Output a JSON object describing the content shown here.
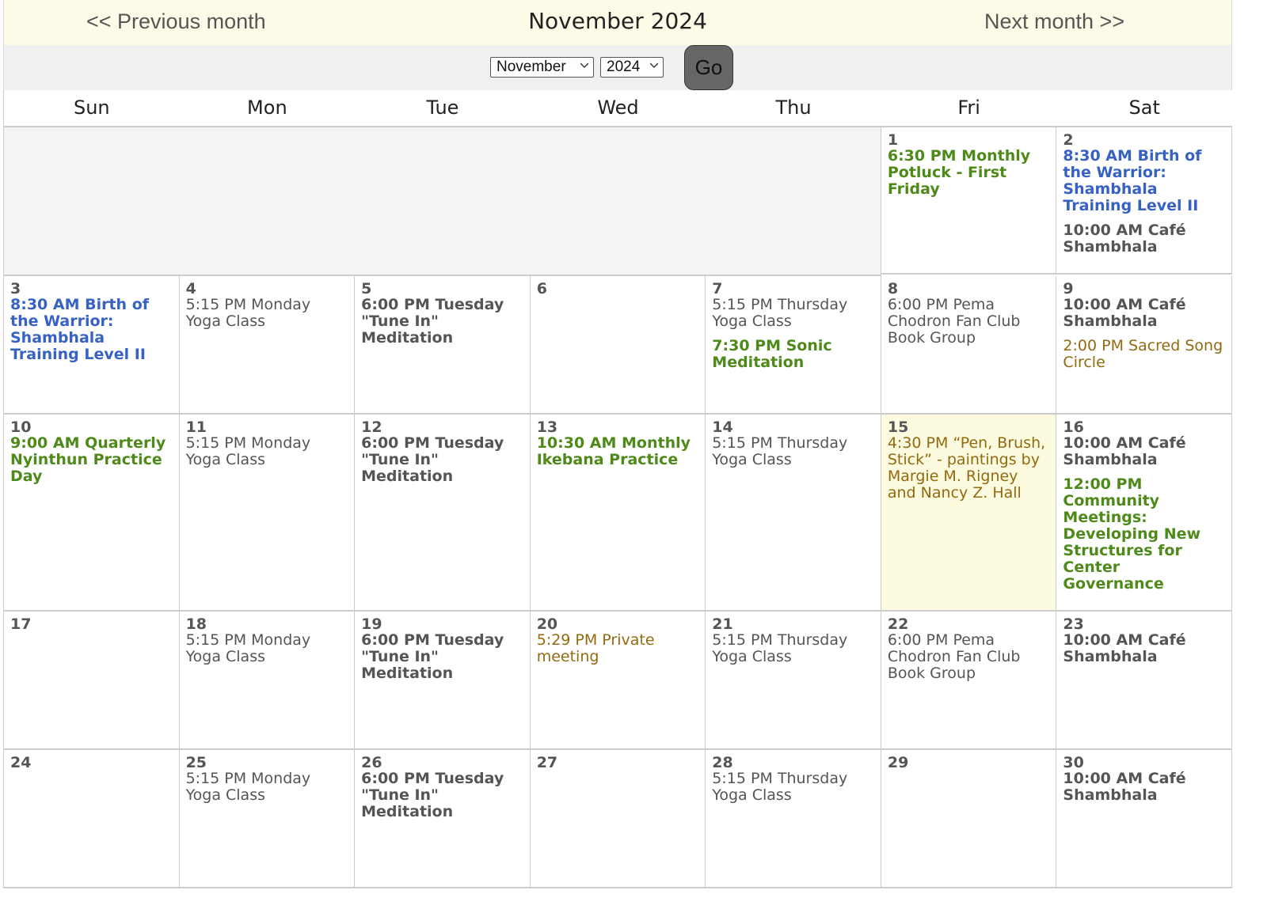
{
  "nav": {
    "prev": "<< Previous month",
    "title": "November 2024",
    "next": "Next month >>"
  },
  "picker": {
    "month": "November",
    "year": "2024",
    "go": "Go"
  },
  "days_of_week": [
    "Sun",
    "Mon",
    "Tue",
    "Wed",
    "Thu",
    "Fri",
    "Sat"
  ],
  "weeks": [
    [
      null,
      null,
      null,
      null,
      null,
      {
        "day": "1",
        "events": [
          {
            "text": "6:30 PM Monthly Potluck - First Friday",
            "style": "b c-green"
          }
        ]
      },
      {
        "day": "2",
        "events": [
          {
            "text": "8:30 AM Birth of the Warrior: Shambhala Training Level II",
            "style": "b c-blue"
          },
          {
            "text": "10:00 AM Café Shambhala",
            "style": "b c-gray"
          }
        ]
      }
    ],
    [
      {
        "day": "3",
        "events": [
          {
            "text": "8:30 AM Birth of the Warrior: Shambhala Training Level II",
            "style": "b c-blue"
          }
        ]
      },
      {
        "day": "4",
        "events": [
          {
            "text": "5:15 PM Monday Yoga Class",
            "style": "c-gray"
          }
        ]
      },
      {
        "day": "5",
        "events": [
          {
            "text": "6:00 PM Tuesday \"Tune In\" Meditation",
            "style": "b c-gray"
          }
        ]
      },
      {
        "day": "6",
        "events": []
      },
      {
        "day": "7",
        "events": [
          {
            "text": "5:15 PM Thursday Yoga Class",
            "style": "c-gray"
          },
          {
            "text": "7:30 PM Sonic Meditation",
            "style": "b c-green"
          }
        ]
      },
      {
        "day": "8",
        "events": [
          {
            "text": "6:00 PM Pema Chodron Fan Club Book Group",
            "style": "c-gray"
          }
        ]
      },
      {
        "day": "9",
        "events": [
          {
            "text": "10:00 AM Café Shambhala",
            "style": "b c-gray"
          },
          {
            "text": "2:00 PM Sacred Song Circle",
            "style": "c-brown"
          }
        ]
      }
    ],
    [
      {
        "day": "10",
        "events": [
          {
            "text": "9:00 AM Quarterly Nyinthun Practice Day",
            "style": "b c-green"
          }
        ]
      },
      {
        "day": "11",
        "events": [
          {
            "text": "5:15 PM Monday Yoga Class",
            "style": "c-gray"
          }
        ]
      },
      {
        "day": "12",
        "events": [
          {
            "text": "6:00 PM Tuesday \"Tune In\" Meditation",
            "style": "b c-gray"
          }
        ]
      },
      {
        "day": "13",
        "events": [
          {
            "text": "10:30 AM Monthly Ikebana Practice",
            "style": "b c-green"
          }
        ]
      },
      {
        "day": "14",
        "events": [
          {
            "text": "5:15 PM Thursday Yoga Class",
            "style": "c-gray"
          }
        ]
      },
      {
        "day": "15",
        "today": true,
        "events": [
          {
            "text": "4:30 PM “Pen, Brush, Stick” - paintings by Margie M. Rigney and Nancy Z. Hall",
            "style": "c-brown"
          }
        ]
      },
      {
        "day": "16",
        "events": [
          {
            "text": "10:00 AM Café Shambhala",
            "style": "b c-gray"
          },
          {
            "text": "12:00 PM Community Meetings: Developing New Structures for Center Governance",
            "style": "b c-green"
          }
        ]
      }
    ],
    [
      {
        "day": "17",
        "events": []
      },
      {
        "day": "18",
        "events": [
          {
            "text": "5:15 PM Monday Yoga Class",
            "style": "c-gray"
          }
        ]
      },
      {
        "day": "19",
        "events": [
          {
            "text": "6:00 PM Tuesday \"Tune In\" Meditation",
            "style": "b c-gray"
          }
        ]
      },
      {
        "day": "20",
        "events": [
          {
            "text": "5:29 PM Private meeting",
            "style": "c-brown"
          }
        ]
      },
      {
        "day": "21",
        "events": [
          {
            "text": "5:15 PM Thursday Yoga Class",
            "style": "c-gray"
          }
        ]
      },
      {
        "day": "22",
        "events": [
          {
            "text": "6:00 PM Pema Chodron Fan Club Book Group",
            "style": "c-gray"
          }
        ]
      },
      {
        "day": "23",
        "events": [
          {
            "text": "10:00 AM Café Shambhala",
            "style": "b c-gray"
          }
        ]
      }
    ],
    [
      {
        "day": "24",
        "events": []
      },
      {
        "day": "25",
        "events": [
          {
            "text": "5:15 PM Monday Yoga Class",
            "style": "c-gray"
          }
        ]
      },
      {
        "day": "26",
        "events": [
          {
            "text": "6:00 PM Tuesday \"Tune In\" Meditation",
            "style": "b c-gray"
          }
        ]
      },
      {
        "day": "27",
        "events": []
      },
      {
        "day": "28",
        "events": [
          {
            "text": "5:15 PM Thursday Yoga Class",
            "style": "c-gray"
          }
        ]
      },
      {
        "day": "29",
        "events": []
      },
      {
        "day": "30",
        "events": [
          {
            "text": "10:00 AM Café Shambhala",
            "style": "b c-gray"
          }
        ]
      }
    ]
  ]
}
